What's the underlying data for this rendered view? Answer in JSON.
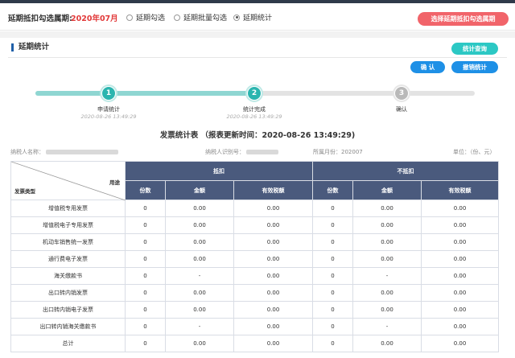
{
  "header": {
    "period_label": "延期抵扣勾选属期:",
    "period_value": "2020年07月",
    "radios": [
      {
        "label": "延期勾选",
        "selected": false
      },
      {
        "label": "延期批量勾选",
        "selected": false
      },
      {
        "label": "延期统计",
        "selected": true
      }
    ],
    "select_period_button": "选择延期抵扣勾选属期"
  },
  "panel": {
    "section_title": "延期统计",
    "query_button": "统计查询",
    "confirm_button": "确 认",
    "cancel_button": "撤销统计"
  },
  "steps": [
    {
      "number": "1",
      "label": "申请统计",
      "time": "2020-08-26 13:49:29",
      "state": "done"
    },
    {
      "number": "2",
      "label": "统计完成",
      "time": "2020-08-26 13:49:29",
      "state": "done"
    },
    {
      "number": "3",
      "label": "确认",
      "time": "",
      "state": "pending"
    }
  ],
  "report": {
    "title": "发票统计表 （报表更新时间：2020-08-26 13:49:29)",
    "taxpayer_name_label": "纳税人名称：",
    "taxpayer_id_label": "纳税人识别号：",
    "period_label": "所属月份：202007",
    "unit_label": "单位：（份、元）"
  },
  "table": {
    "corner_left": "发票类型",
    "corner_right": "用途",
    "group_deduct": "抵扣",
    "group_nodeduct": "不抵扣",
    "sub_headers": [
      "份数",
      "金额",
      "有效税额",
      "份数",
      "金额",
      "有效税额"
    ],
    "rows": [
      {
        "type": "增值税专用发票",
        "cells": [
          "0",
          "0.00",
          "0.00",
          "0",
          "0.00",
          "0.00"
        ]
      },
      {
        "type": "增值税电子专用发票",
        "cells": [
          "0",
          "0.00",
          "0.00",
          "0",
          "0.00",
          "0.00"
        ]
      },
      {
        "type": "机动车销售统一发票",
        "cells": [
          "0",
          "0.00",
          "0.00",
          "0",
          "0.00",
          "0.00"
        ]
      },
      {
        "type": "通行费电子发票",
        "cells": [
          "0",
          "0.00",
          "0.00",
          "0",
          "0.00",
          "0.00"
        ]
      },
      {
        "type": "海关缴款书",
        "cells": [
          "0",
          "-",
          "0.00",
          "0",
          "-",
          "0.00"
        ]
      },
      {
        "type": "出口转内销发票",
        "cells": [
          "0",
          "0.00",
          "0.00",
          "0",
          "0.00",
          "0.00"
        ]
      },
      {
        "type": "出口转内销电子发票",
        "cells": [
          "0",
          "0.00",
          "0.00",
          "0",
          "0.00",
          "0.00"
        ]
      },
      {
        "type": "出口转内销海关缴款书",
        "cells": [
          "0",
          "-",
          "0.00",
          "0",
          "-",
          "0.00"
        ]
      },
      {
        "type": "总计",
        "cells": [
          "0",
          "0.00",
          "0.00",
          "0",
          "0.00",
          "0.00"
        ]
      }
    ]
  },
  "colors": {
    "accent_red": "#e23a3a",
    "teal": "#2bb5af",
    "blue": "#1e90e6",
    "table_header": "#4a5a7d"
  }
}
